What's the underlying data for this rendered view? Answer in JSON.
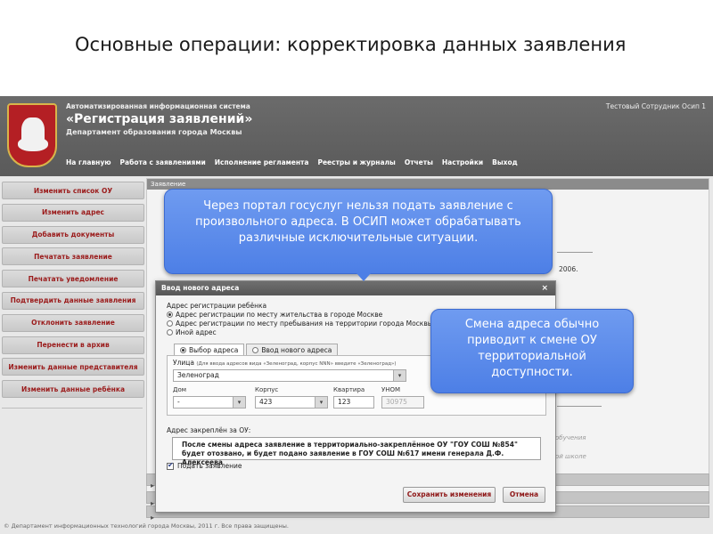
{
  "slide": {
    "title": "Основные операции: корректировка данных заявления"
  },
  "app": {
    "system_subtitle": "Автоматизированная информационная система",
    "system_title": "«Регистрация заявлений»",
    "department": "Департамент образования города Москвы",
    "user": "Тестовый Сотрудник Осип 1",
    "nav": [
      "На главную",
      "Работа с заявлениями",
      "Исполнение регламента",
      "Реестры и журналы",
      "Отчеты",
      "Настройки",
      "Выход"
    ],
    "sidebar": [
      "Изменить список ОУ",
      "Изменить адрес",
      "Добавить документы",
      "Печатать заявление",
      "Печатать уведомление",
      "Подтвердить данные заявления",
      "Отклонить заявление",
      "Перенести в архив",
      "Изменить данные представителя",
      "Изменить данные ребёнка"
    ],
    "panel_title": "Заявление",
    "panel_date": "2006.",
    "panel_faint1": "обучения",
    "panel_faint2": "ой школе",
    "footer": "© Департамент информационных технологий города Москвы, 2011 г. Все права защищены."
  },
  "dialog": {
    "title": "Ввод нового адреса",
    "close": "×",
    "reg_label": "Адрес регистрации ребёнка",
    "reg_options": [
      "Адрес регистрации по месту жительства в городе Москве",
      "Адрес регистрации по месту пребывания на территории города Москвы",
      "Иной адрес"
    ],
    "tab_select": "Выбор адреса",
    "tab_new": "Ввод нового адреса",
    "street_label": "Улица",
    "street_hint": "(Для ввода адресов вида «Зеленоград, корпус NNN» введите «Зеленоград»)",
    "street_value": "Зеленоград",
    "house_label": "Дом",
    "house_value": "-",
    "korpus_label": "Корпус",
    "korpus_value": "423",
    "apt_label": "Квартира",
    "apt_value": "123",
    "unom_label": "УНОМ",
    "unom_value": "30975",
    "ou_label": "Адрес закреплён за ОУ:",
    "ou_text": "После смены адреса заявление в территориально-закреплённое ОУ \"ГОУ СОШ №854\" будет отозвано, и будет подано заявление в ГОУ СОШ №617 имени генерала Д.Ф. Алексеева",
    "submit_check": "Подать заявление",
    "save_button": "Сохранить изменения",
    "cancel_button": "Отмена"
  },
  "callouts": {
    "portal": "Через портал госуслуг нельзя подать заявление с произвольного адреса. В ОСИП может обрабатывать различные исключительные ситуации.",
    "address": "Смена адреса обычно приводит к смене ОУ территориальной доступности."
  },
  "colors": {
    "header_bg": "#5f5f5f",
    "sidebar_text": "#9b1b1b",
    "callout_bg": "#5b8cec",
    "crest_red": "#b41f24"
  }
}
